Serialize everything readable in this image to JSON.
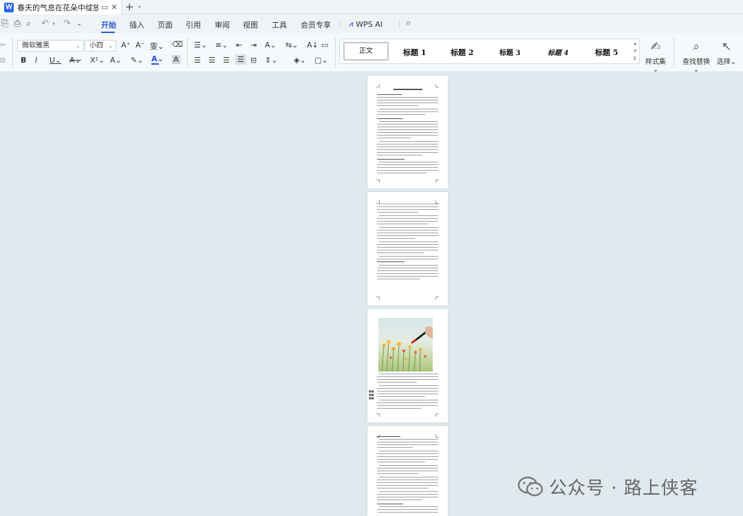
{
  "titlebar": {
    "doc_title": "春天的气息在花朵中绽放.docx",
    "app_badge": "W",
    "new_tab_symbol": "+",
    "new_tab_arrow": "⌄"
  },
  "menu": {
    "items": [
      "开始",
      "插入",
      "页面",
      "引用",
      "审阅",
      "视图",
      "工具",
      "会员专享"
    ],
    "wps_ai_label": "WPS AI",
    "active": "开始"
  },
  "ribbon": {
    "font_family": "微软雅黑",
    "font_size": "小四",
    "styles": {
      "normal": "正文",
      "h1": "标题 1",
      "h2": "标题 2",
      "h3": "标题 3",
      "h4": "标题 4",
      "h5": "标题 5"
    },
    "style_set_label": "样式集",
    "find_replace_label": "查找替换",
    "select_label": "选择"
  },
  "watermark": {
    "text": "公众号 · 路上侠客"
  },
  "colors": {
    "accent": "#2a5bd7",
    "background": "#dfe9ee",
    "font_color_bar": "#1f4fd8"
  }
}
